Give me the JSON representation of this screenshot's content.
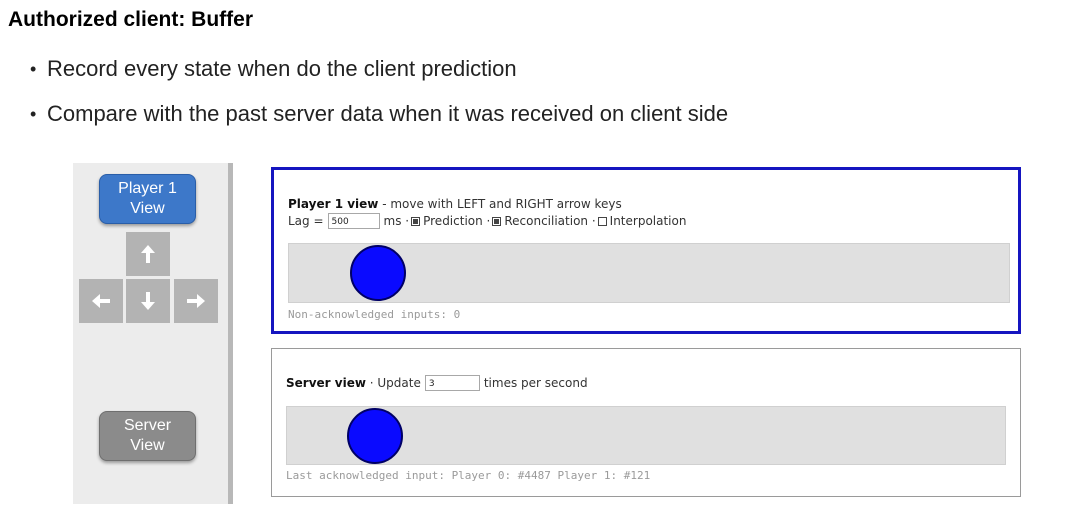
{
  "slide": {
    "title": "Authorized client: Buffer",
    "bullets": [
      "Record every state when do the client prediction",
      "Compare with the past server data when it was received on client side"
    ]
  },
  "controls": {
    "player1_button": "Player 1\nView",
    "server_button": "Server\nView",
    "arrows": [
      "arrow-up-icon",
      "arrow-left-icon",
      "arrow-down-icon",
      "arrow-right-icon"
    ],
    "player_button_color": "#3d78c9",
    "server_button_color": "#8b8b8b"
  },
  "player_view": {
    "heading": "Player 1 view",
    "instructions": " - move with LEFT and RIGHT arrow keys",
    "lag_label": "Lag =",
    "lag_value": "500",
    "lag_unit": "ms ·",
    "prediction_label": "Prediction ·",
    "prediction_checked": true,
    "reconciliation_label": "Reconciliation ·",
    "reconciliation_checked": true,
    "interpolation_label": "Interpolation",
    "interpolation_checked": false,
    "status": "Non-acknowledged inputs: 0",
    "border_color": "#1515c0",
    "ball_color": "#0a0aff"
  },
  "server_view": {
    "heading": "Server view",
    "update_label": "· Update",
    "update_value": "3",
    "update_unit": "times per second",
    "status": "Last acknowledged input: Player 0: #4487 Player 1: #121",
    "ball_color": "#0a0aff"
  }
}
